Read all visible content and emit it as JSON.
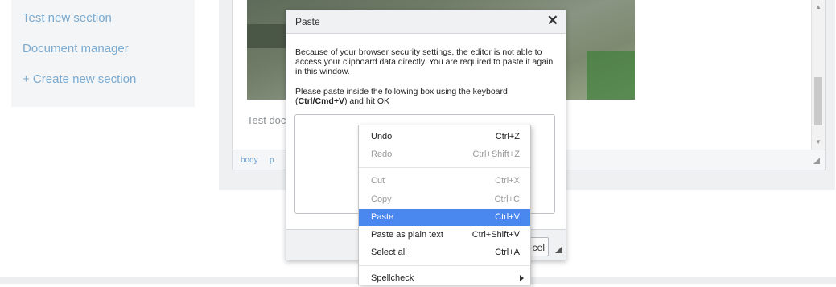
{
  "sidebar": {
    "items": [
      {
        "label": "Test new section"
      },
      {
        "label": "Document manager"
      },
      {
        "label": "+ Create new section"
      }
    ]
  },
  "editor": {
    "text": "Test docu",
    "path": [
      "body",
      "p"
    ]
  },
  "dialog": {
    "title": "Paste",
    "close_glyph": "✕",
    "message": "Because of your browser security settings, the editor is not able to access your clipboard data directly. You are required to paste it again in this window.",
    "instruction_prefix": "Please paste inside the following box using the keyboard (",
    "instruction_keys": "Ctrl/Cmd+V",
    "instruction_suffix": ") and hit OK",
    "cancel_label": "cel"
  },
  "context_menu": {
    "items": [
      {
        "label": "Undo",
        "shortcut": "Ctrl+Z",
        "enabled": true
      },
      {
        "label": "Redo",
        "shortcut": "Ctrl+Shift+Z",
        "enabled": false
      },
      {
        "label": "Cut",
        "shortcut": "Ctrl+X",
        "enabled": false
      },
      {
        "label": "Copy",
        "shortcut": "Ctrl+C",
        "enabled": false
      },
      {
        "label": "Paste",
        "shortcut": "Ctrl+V",
        "enabled": true,
        "highlighted": true
      },
      {
        "label": "Paste as plain text",
        "shortcut": "Ctrl+Shift+V",
        "enabled": true
      },
      {
        "label": "Select all",
        "shortcut": "Ctrl+A",
        "enabled": true
      },
      {
        "label": "Spellcheck",
        "shortcut": "",
        "enabled": true,
        "submenu": true
      }
    ]
  },
  "colors": {
    "sidebar_link": "#7aaad0",
    "menu_highlight": "#4a88f0"
  }
}
